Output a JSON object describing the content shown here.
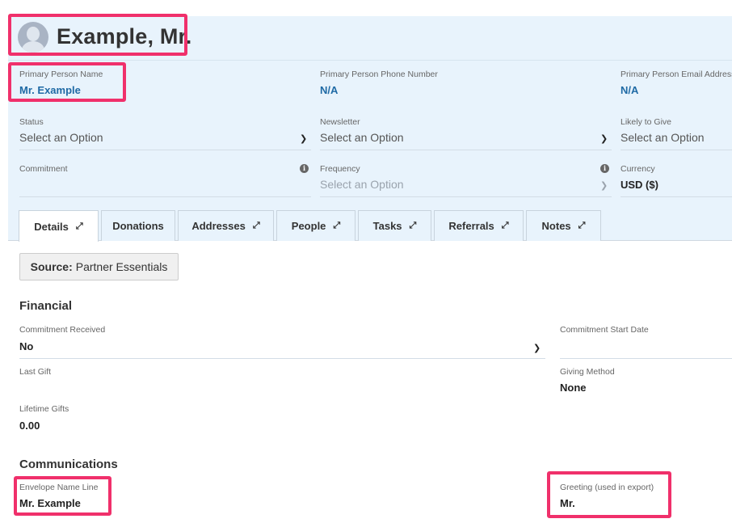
{
  "header": {
    "title": "Example, Mr."
  },
  "fields": {
    "primary_person_name": {
      "label": "Primary Person Name",
      "value": "Mr. Example"
    },
    "primary_person_phone": {
      "label": "Primary Person Phone Number",
      "value": "N/A"
    },
    "primary_person_email": {
      "label": "Primary Person Email Address",
      "value": "N/A"
    },
    "status": {
      "label": "Status",
      "value": "Select an Option"
    },
    "newsletter": {
      "label": "Newsletter",
      "value": "Select an Option"
    },
    "likely_to_give": {
      "label": "Likely to Give",
      "value": "Select an Option"
    },
    "commitment": {
      "label": "Commitment",
      "value": ""
    },
    "frequency": {
      "label": "Frequency",
      "value": "Select an Option"
    },
    "currency": {
      "label": "Currency",
      "value": "USD ($)"
    }
  },
  "tabs": [
    {
      "label": "Details",
      "expandable": true,
      "active": true
    },
    {
      "label": "Donations",
      "expandable": false,
      "active": false
    },
    {
      "label": "Addresses",
      "expandable": true,
      "active": false
    },
    {
      "label": "People",
      "expandable": true,
      "active": false
    },
    {
      "label": "Tasks",
      "expandable": true,
      "active": false
    },
    {
      "label": "Referrals",
      "expandable": true,
      "active": false
    },
    {
      "label": "Notes",
      "expandable": true,
      "active": false
    }
  ],
  "source": {
    "label": "Source:",
    "value": "Partner Essentials"
  },
  "financial": {
    "title": "Financial",
    "commitment_received": {
      "label": "Commitment Received",
      "value": "No"
    },
    "commitment_start_date": {
      "label": "Commitment Start Date",
      "value": ""
    },
    "last_gift": {
      "label": "Last Gift",
      "value": ""
    },
    "giving_method": {
      "label": "Giving Method",
      "value": "None"
    },
    "lifetime_gifts": {
      "label": "Lifetime Gifts",
      "value": "0.00"
    }
  },
  "communications": {
    "title": "Communications",
    "envelope_name_line": {
      "label": "Envelope Name Line",
      "value": "Mr. Example"
    },
    "greeting": {
      "label": "Greeting (used in export)",
      "value": "Mr."
    }
  },
  "icons": {
    "chevron": "chevron-down-icon",
    "info": "info-icon",
    "expand": "expand-arrows-icon",
    "avatar": "person-avatar-icon"
  },
  "colors": {
    "highlight": "#f0306b",
    "header_bg": "#e8f3fc",
    "link": "#1f6aa5"
  }
}
